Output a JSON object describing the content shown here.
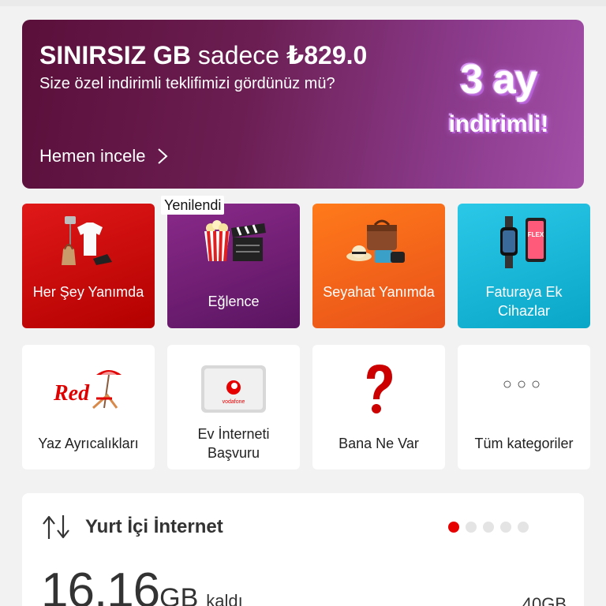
{
  "banner": {
    "title_strong": "SINIRSIZ GB",
    "title_light": "sadece",
    "price": "₺829.0",
    "subtitle": "Size özel indirimli teklifimizi gördünüz mü?",
    "cta": "Hemen incele",
    "promo_line1": "3 ay",
    "promo_line2": "indirimli!"
  },
  "categories": [
    {
      "label": "Her Şey Yanımda",
      "icon": "clothing-accessories-icon",
      "color": "#e01818"
    },
    {
      "label": "Eğlence",
      "icon": "popcorn-clapperboard-icon",
      "color": "#7a2578"
    },
    {
      "label": "Seyahat Yanımda",
      "icon": "travel-bag-icon",
      "color": "#ff6a1a"
    },
    {
      "label": "Faturaya Ek Cihazlar",
      "icon": "smartwatch-phone-icon",
      "color": "#1db8dc"
    }
  ],
  "new_tag": "Yenilendi",
  "shortcuts": [
    {
      "label": "Yaz Ayrıcalıkları",
      "icon": "red-beach-logo-icon"
    },
    {
      "label": "Ev İnterneti Başvuru",
      "icon": "vodafone-modem-icon",
      "device_text": "vodafone"
    },
    {
      "label": "Bana Ne Var",
      "icon": "question-mark-icon"
    },
    {
      "label": "Tüm kategoriler",
      "icon": "more-dots-icon",
      "dots": "○○○"
    }
  ],
  "usage": {
    "title": "Yurt İçi İnternet",
    "value": "16.16",
    "unit": "GB",
    "remaining_label": "kaldı",
    "total": "40GB",
    "pager_count": 5,
    "pager_active": 0
  },
  "colors": {
    "accent": "#e60000"
  }
}
